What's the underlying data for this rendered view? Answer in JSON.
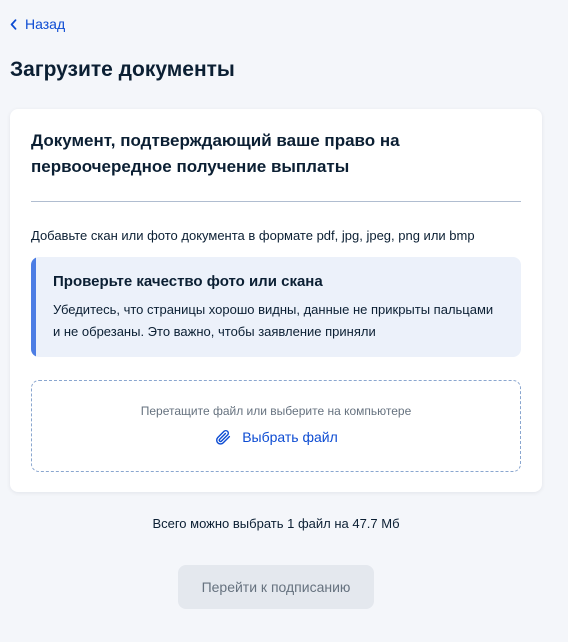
{
  "nav": {
    "back_label": "Назад",
    "back_icon": "chevron-left-icon"
  },
  "page": {
    "title": "Загрузите документы"
  },
  "card": {
    "title": "Документ, подтверждающий ваше право на первоочередное получение выплаты",
    "hint": "Добавьте скан или фото документа в формате pdf, jpg, jpeg, png или bmp",
    "callout": {
      "title": "Проверьте качество фото или скана",
      "text": "Убедитесь, что страницы хорошо видны, данные не прикрыты пальцами и не обрезаны. Это важно, чтобы заявление приняли",
      "accent_color": "#4c7de4"
    },
    "dropzone": {
      "hint": "Перетащите файл или выберите на компьютере",
      "choose_label": "Выбрать файл",
      "choose_icon": "paperclip-icon"
    }
  },
  "limit_text": "Всего можно выбрать 1 файл на 47.7 Мб",
  "submit": {
    "label": "Перейти к подписанию",
    "disabled": true
  },
  "colors": {
    "link": "#0d4cd3",
    "background": "#f4f6fa",
    "text": "#0b1f33"
  }
}
